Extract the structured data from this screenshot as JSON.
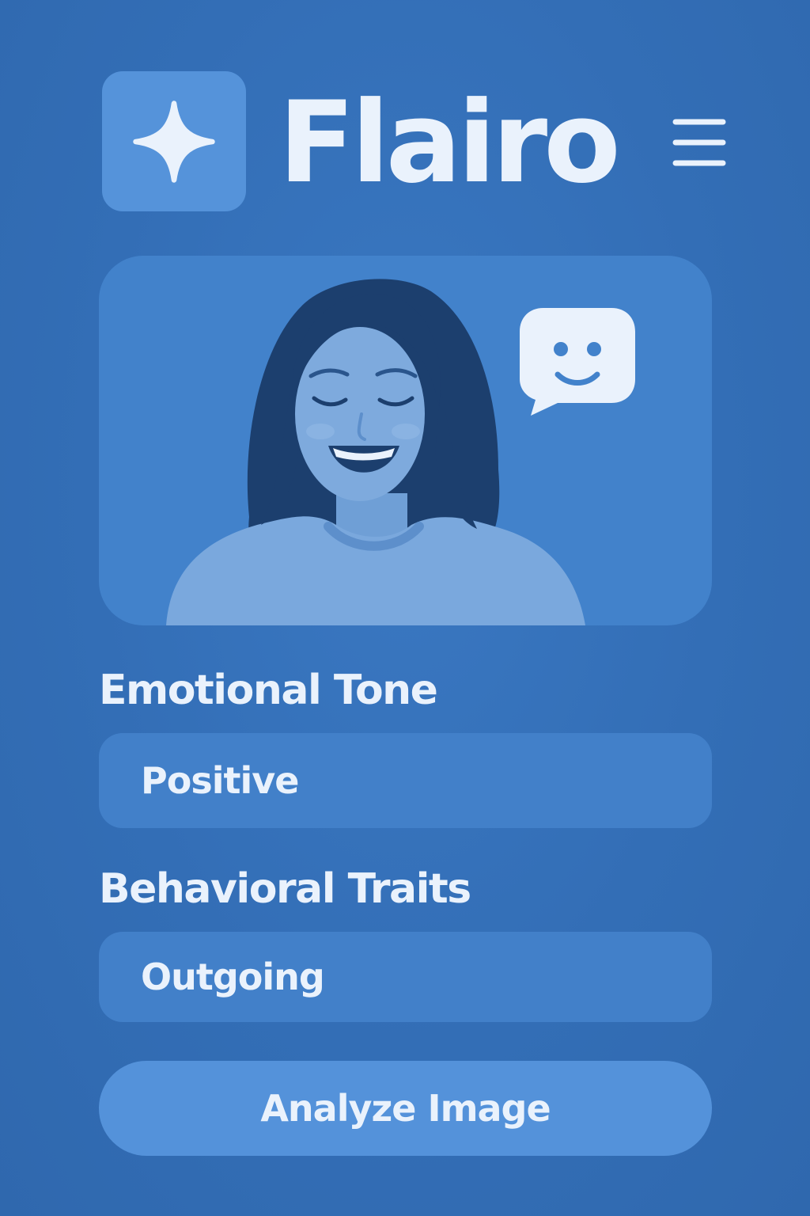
{
  "header": {
    "app_name": "Flairo",
    "logo_icon": "sparkle-icon",
    "menu_icon": "hamburger-menu-icon"
  },
  "photo": {
    "subject": "portrait-photo",
    "badge_icon": "smiley-chat-bubble-icon"
  },
  "emotional_tone": {
    "label": "Emotional Tone",
    "value": "Positive"
  },
  "behavioral_traits": {
    "label": "Behavioral Traits",
    "value": "Outgoing"
  },
  "actions": {
    "analyze_label": "Analyze Image"
  },
  "colors": {
    "background": "#3470b8",
    "card": "#4282cb",
    "field": "#4280c9",
    "accent": "#5593da",
    "text": "#eaf2fc"
  }
}
